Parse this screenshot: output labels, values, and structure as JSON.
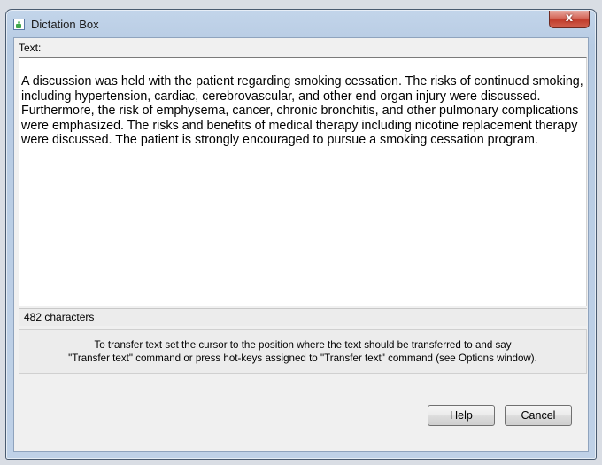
{
  "window": {
    "title": "Dictation Box",
    "close_glyph": "x"
  },
  "text_label": "Text:",
  "text_content": "A discussion was held with the patient regarding smoking cessation. The risks of continued smoking, including hypertension, cardiac, cerebrovascular, and other end organ injury were discussed. Furthermore, the risk of emphysema, cancer, chronic bronchitis, and other pulmonary complications were emphasized.  The risks and benefits of medical therapy including nicotine replacement therapy were discussed. The patient is strongly encouraged to pursue a smoking cessation program.",
  "char_count": "482 characters",
  "hint": {
    "line1": "To transfer text set the cursor to the position where the text should be transferred to and say",
    "line2": "\"Transfer text\" command or press hot-keys assigned to \"Transfer text\" command (see Options window)."
  },
  "buttons": {
    "help": "Help",
    "cancel": "Cancel"
  },
  "icons": {
    "app": "dictation-app-icon",
    "close": "close-icon"
  }
}
